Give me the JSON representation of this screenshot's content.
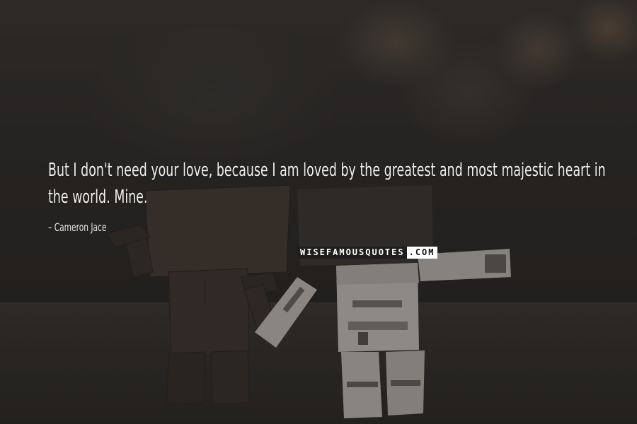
{
  "quote": {
    "text": "But I don't need your love, because I am loved by the greatest and most majestic heart in the world. Mine.",
    "author": "Cameron Jace"
  },
  "watermark": {
    "left": "WISEFAMOUSQUOTES",
    "right": ".COM"
  }
}
